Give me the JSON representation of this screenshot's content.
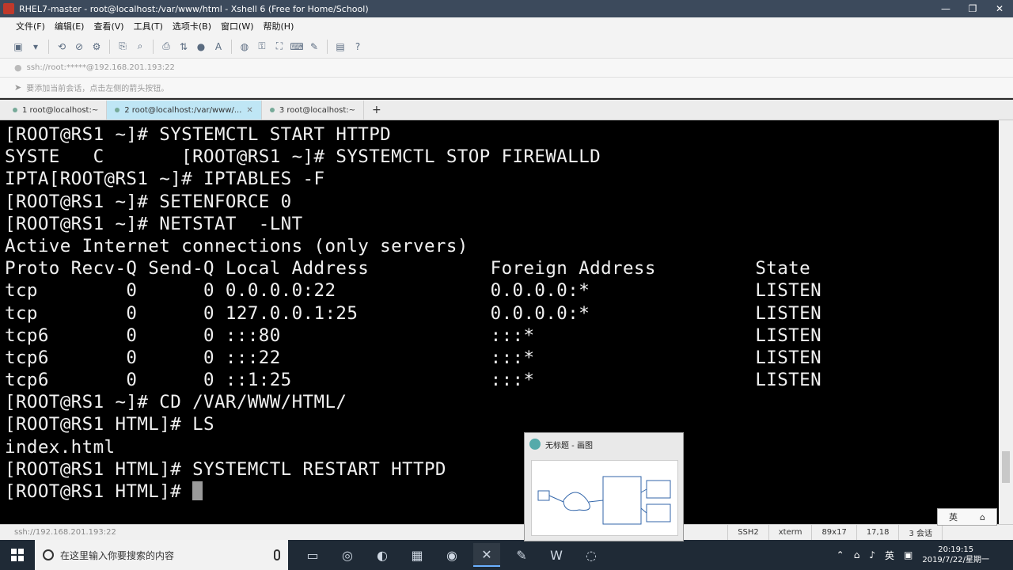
{
  "window": {
    "title": "RHEL7-master - root@localhost:/var/www/html - Xshell 6 (Free for Home/School)",
    "minimize": "—",
    "restore": "❐",
    "close": "✕"
  },
  "menu": [
    "文件(F)",
    "编辑(E)",
    "查看(V)",
    "工具(T)",
    "选项卡(B)",
    "窗口(W)",
    "帮助(H)"
  ],
  "address_bar": {
    "text": "ssh://root:*****@192.168.201.193:22"
  },
  "hint_bar": {
    "text": "要添加当前会话，点击左侧的箭头按钮。"
  },
  "tabs": [
    {
      "label": "1 root@localhost:~",
      "active": false
    },
    {
      "label": "2 root@localhost:/var/www/...",
      "active": true
    },
    {
      "label": "3 root@localhost:~",
      "active": false
    }
  ],
  "tab_add": "+",
  "terminal": {
    "lines": [
      "[ROOT@RS1 ~]# SYSTEMCTL START HTTPD",
      "SYSTE   C       [ROOT@RS1 ~]# SYSTEMCTL STOP FIREWALLD",
      "IPTA[ROOT@RS1 ~]# IPTABLES -F",
      "[ROOT@RS1 ~]# SETENFORCE 0",
      "[ROOT@RS1 ~]# NETSTAT  -LNT",
      "Active Internet connections (only servers)",
      "Proto Recv-Q Send-Q Local Address           Foreign Address         State",
      "tcp        0      0 0.0.0.0:22              0.0.0.0:*               LISTEN",
      "tcp        0      0 127.0.0.1:25            0.0.0.0:*               LISTEN",
      "tcp6       0      0 :::80                   :::*                    LISTEN",
      "tcp6       0      0 :::22                   :::*                    LISTEN",
      "tcp6       0      0 ::1:25                  :::*                    LISTEN",
      "[ROOT@RS1 ~]# CD /VAR/WWW/HTML/",
      "[ROOT@RS1 HTML]# LS",
      "index.html",
      "[ROOT@RS1 HTML]# SYSTEMCTL RESTART HTTPD",
      "[ROOT@RS1 HTML]# "
    ]
  },
  "status_bar": {
    "connection": "ssh://192.168.201.193:22",
    "protocol": "SSH2",
    "term": "xterm",
    "size": "89x17",
    "cursor": "17,18",
    "sessions": "3 会话"
  },
  "ime": {
    "label": "英",
    "extra": "⌂"
  },
  "preview": {
    "title": "无标题 - 画图"
  },
  "taskbar": {
    "search_placeholder": "在这里输入你要搜索的内容",
    "tray_lang": "英",
    "time": "20:19:15",
    "date": "2019/7/22/星期一"
  }
}
